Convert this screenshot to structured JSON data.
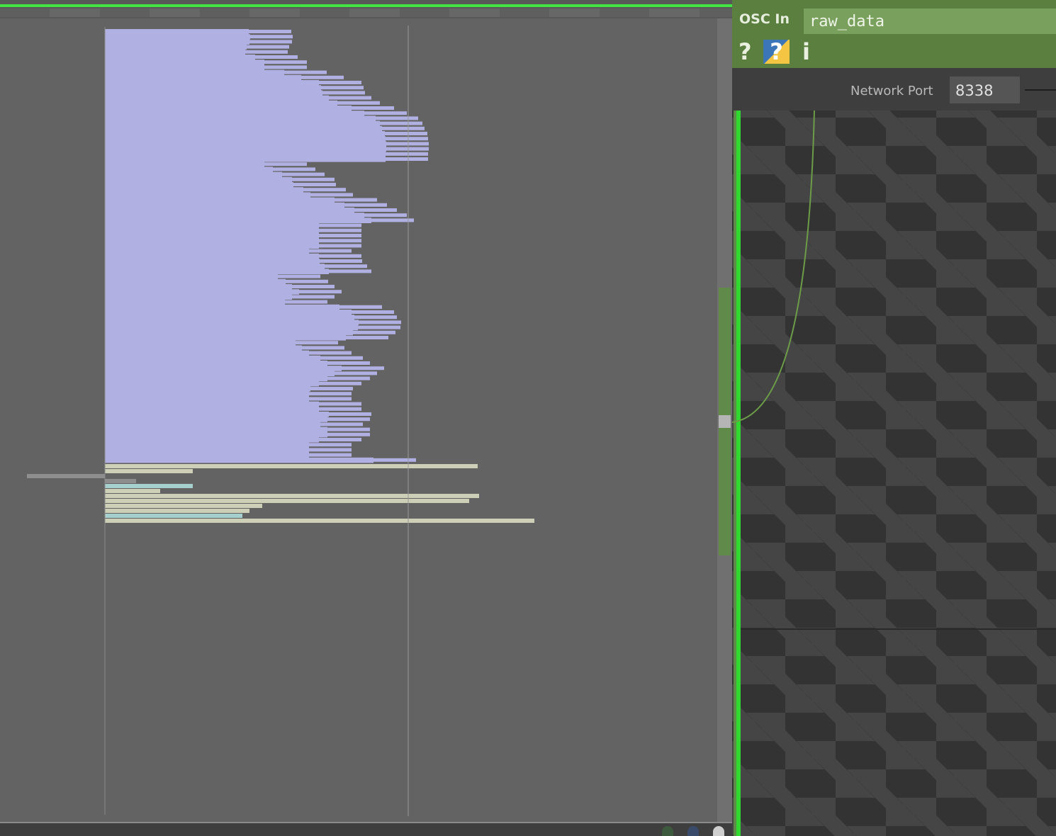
{
  "operator": {
    "type": "OSC In",
    "name": "raw_data"
  },
  "header_icons": {
    "help": "?",
    "python_help": "?",
    "info": "i"
  },
  "parameters": {
    "network_port_label": "Network Port",
    "network_port_value": "8338"
  },
  "colors": {
    "channel_bar": "#b1b0e2",
    "extra_bar_beige": "#cdcfb6",
    "extra_bar_teal": "#a5d0cd",
    "extra_bar_gray": "#8e8e8e",
    "highlight_green": "#43e343",
    "operator_header": "#5b7f3f"
  },
  "chart_data": {
    "type": "bar",
    "orientation": "horizontal",
    "description": "Channel values of the OSC In CHOP, one horizontal bar per channel (values in screen units relative to zero line)",
    "channel_values": [
      263,
      265,
      264,
      260,
      258,
      272,
      285,
      285,
      313,
      337,
      362,
      365,
      367,
      376,
      388,
      408,
      426,
      442,
      448,
      451,
      455,
      456,
      457,
      457,
      456,
      456,
      285,
      297,
      310,
      324,
      326,
      340,
      350,
      384,
      398,
      412,
      426,
      436,
      362,
      362,
      362,
      362,
      362,
      348,
      362,
      363,
      370,
      376,
      304,
      315,
      324,
      334,
      324,
      314,
      391,
      408,
      412,
      418,
      417,
      410,
      400,
      329,
      338,
      348,
      364,
      374,
      394,
      384,
      374,
      362,
      350,
      348,
      348,
      362,
      362,
      376,
      374,
      364,
      374,
      374,
      362,
      348,
      348,
      348,
      439
    ],
    "extra_rows": [
      {
        "color": "beige",
        "value": 526
      },
      {
        "color": "beige",
        "value": 124
      },
      {
        "color": "gray",
        "value": -110
      },
      {
        "color": "gray",
        "value": 44
      },
      {
        "color": "teal",
        "value": 124
      },
      {
        "color": "beige",
        "value": 78
      },
      {
        "color": "beige",
        "value": 528
      },
      {
        "color": "beige",
        "value": 514
      },
      {
        "color": "beige",
        "value": 222
      },
      {
        "color": "beige",
        "value": 204
      },
      {
        "color": "teal",
        "value": 194
      },
      {
        "color": "beige",
        "value": 606
      }
    ],
    "zero_line": 0,
    "reference_line": 428,
    "grid": false
  }
}
